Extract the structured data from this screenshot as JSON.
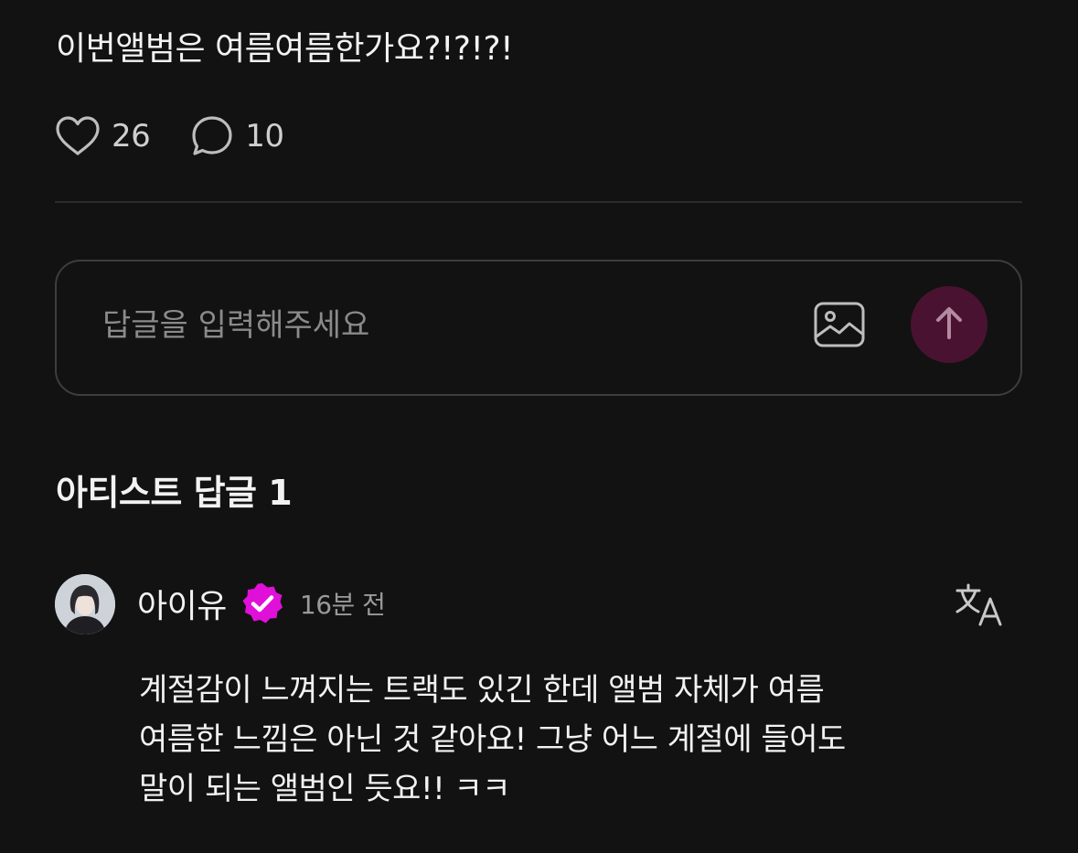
{
  "post": {
    "text": "이번앨범은 여름여름한가요?!?!?!",
    "likes": "26",
    "comments": "10"
  },
  "reply_box": {
    "placeholder": "답글을 입력해주세요"
  },
  "artist_replies": {
    "title": "아티스트 답글 1",
    "items": [
      {
        "author": "아이유",
        "time": "16분 전",
        "lines": [
          "계절감이 느껴지는 트랙도 있긴 한데 앨범 자체가 여름",
          "여름한 느낌은 아닌 것 같아요! 그냥 어느 계절에 들어도",
          "말이 되는 앨범인 듯요!! ㅋㅋ"
        ]
      }
    ]
  },
  "icons": {
    "like": "heart-icon",
    "comment": "speech-bubble-icon",
    "image": "image-icon",
    "send": "arrow-up-icon",
    "verified": "verified-badge-icon",
    "translate": "translate-icon"
  },
  "colors": {
    "background": "#121212",
    "send_button": "#4a1231",
    "verified_badge": "#e010d8"
  }
}
